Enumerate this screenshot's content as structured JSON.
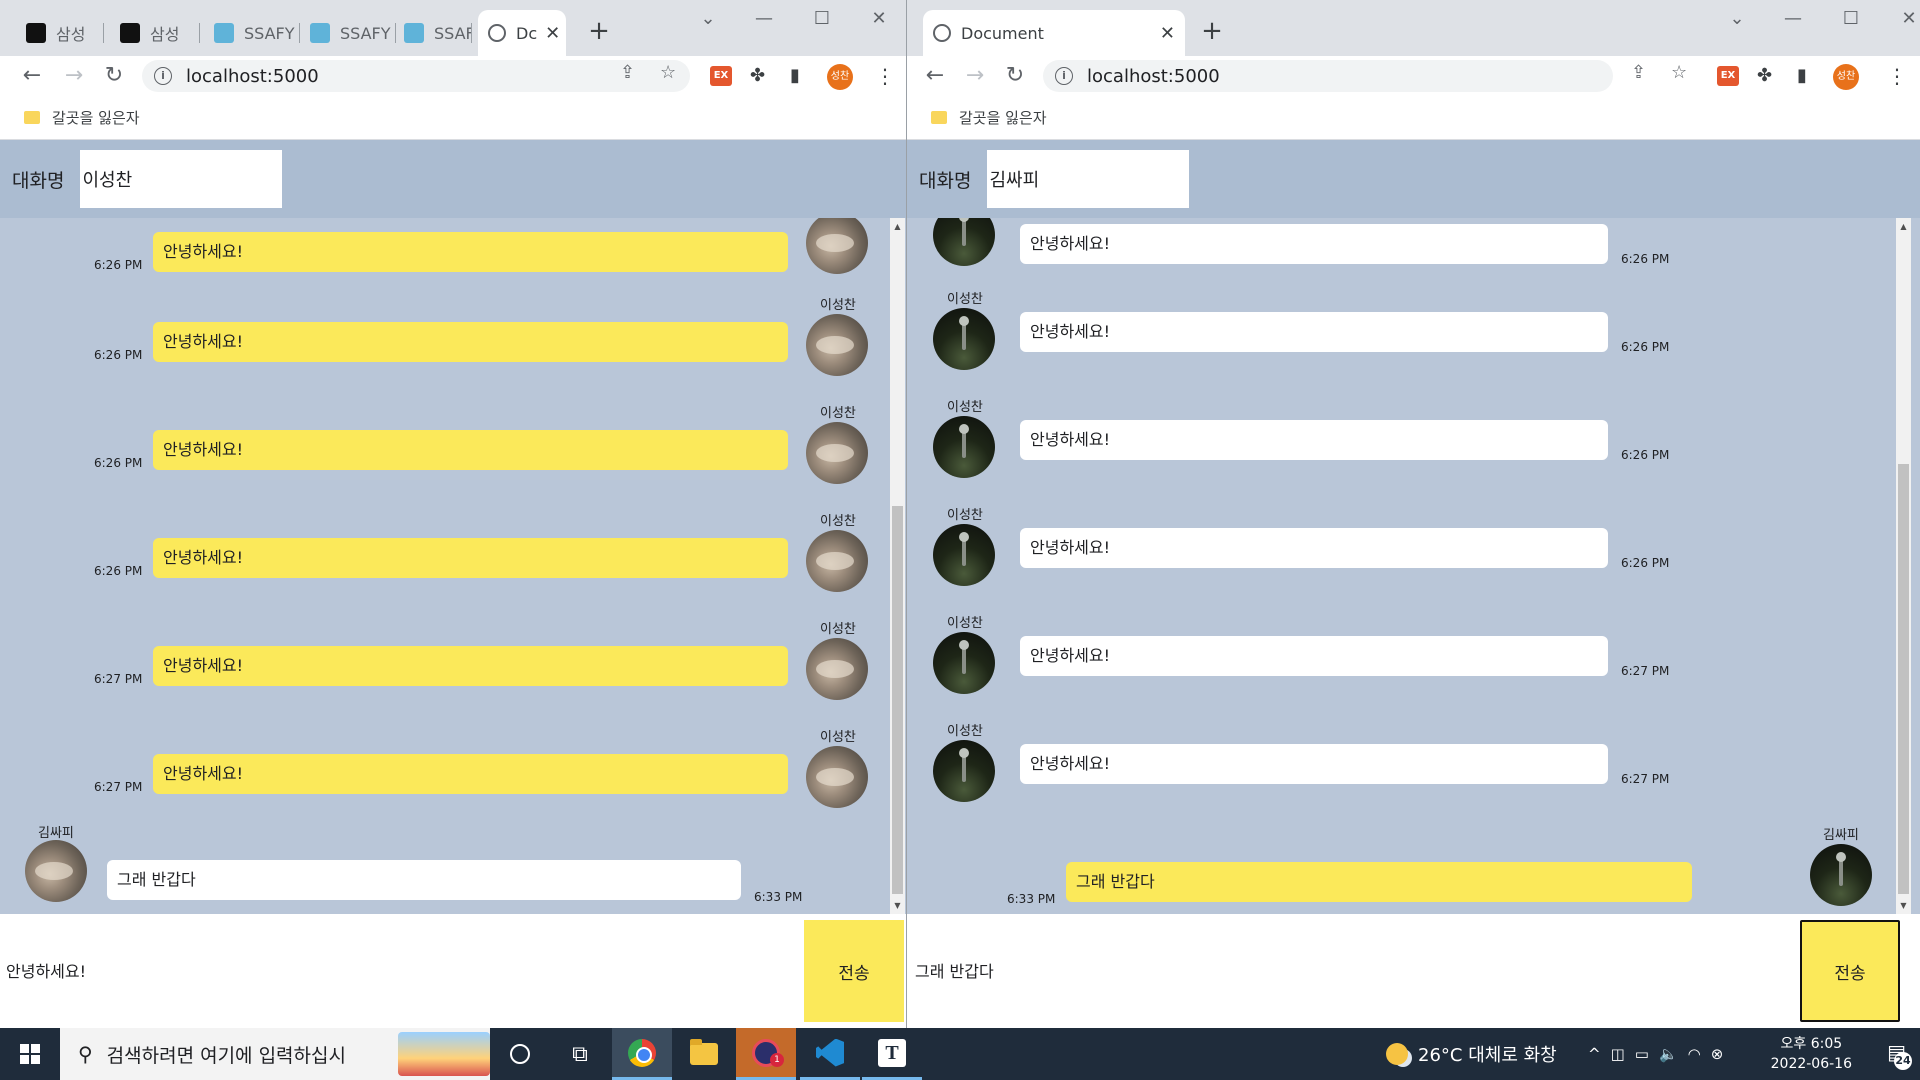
{
  "left": {
    "tabs": [
      "삼성",
      "삼성",
      "SSAFY",
      "SSAFY",
      "SSAFY",
      "Dc"
    ],
    "url": "localhost:5000",
    "bookmark": "갈곳을 잃은자",
    "profile_initials": "성찬",
    "chat_title_label": "대화명",
    "chat_title_value": "이성찬",
    "messages": [
      {
        "text": "안녕하세요!",
        "time": "6:26 PM",
        "user": ""
      },
      {
        "text": "안녕하세요!",
        "time": "6:26 PM",
        "user": "이성찬"
      },
      {
        "text": "안녕하세요!",
        "time": "6:26 PM",
        "user": "이성찬"
      },
      {
        "text": "안녕하세요!",
        "time": "6:26 PM",
        "user": "이성찬"
      },
      {
        "text": "안녕하세요!",
        "time": "6:27 PM",
        "user": "이성찬"
      },
      {
        "text": "안녕하세요!",
        "time": "6:27 PM",
        "user": "이성찬"
      }
    ],
    "reply": {
      "user": "김싸피",
      "text": "그래 반갑다",
      "time": "6:33 PM"
    },
    "composer_text": "안녕하세요!",
    "send_label": "전송"
  },
  "right": {
    "tab_title": "Document",
    "url": "localhost:5000",
    "bookmark": "갈곳을 잃은자",
    "profile_initials": "성찬",
    "chat_title_label": "대화명",
    "chat_title_value": "김싸피",
    "messages": [
      {
        "text": "안녕하세요!",
        "time": "6:26 PM",
        "user": ""
      },
      {
        "text": "안녕하세요!",
        "time": "6:26 PM",
        "user": "이성찬"
      },
      {
        "text": "안녕하세요!",
        "time": "6:26 PM",
        "user": "이성찬"
      },
      {
        "text": "안녕하세요!",
        "time": "6:26 PM",
        "user": "이성찬"
      },
      {
        "text": "안녕하세요!",
        "time": "6:27 PM",
        "user": "이성찬"
      },
      {
        "text": "안녕하세요!",
        "time": "6:27 PM",
        "user": "이성찬"
      }
    ],
    "reply": {
      "user": "김싸피",
      "text": "그래 반갑다",
      "time": "6:33 PM"
    },
    "composer_text": "그래 반갑다",
    "send_label": "전송"
  },
  "taskbar": {
    "search_placeholder": "검색하려면 여기에 입력하십시",
    "weather": "26°C 대체로 화창",
    "time": "오후 6:05",
    "date": "2022-06-16",
    "notification_count": "24",
    "app_badge": "1"
  },
  "icons": {
    "ex_extension": "EX",
    "taskbar_t_app": "T"
  },
  "colors": {
    "chat_bg": "#b9c6d8",
    "title_bar_bg": "#abbcd1",
    "bubble_yellow": "#fbe95a",
    "taskbar_bg": "#1f2c3b"
  }
}
